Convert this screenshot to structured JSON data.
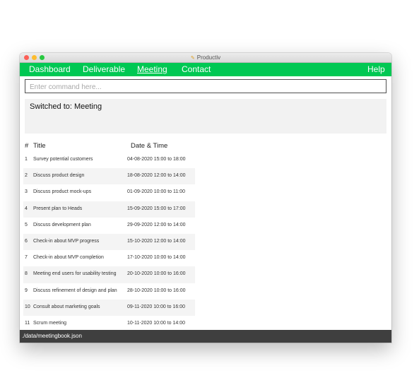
{
  "window": {
    "title": "Productiv",
    "icon": "app-icon"
  },
  "menu": {
    "items": [
      {
        "label": "Dashboard"
      },
      {
        "label": "Deliverable"
      },
      {
        "label": "Meeting",
        "active": true
      },
      {
        "label": "Contact"
      }
    ],
    "help_label": "Help"
  },
  "command": {
    "placeholder": "Enter command here...",
    "value": ""
  },
  "result": {
    "message": "Switched to: Meeting"
  },
  "table": {
    "headers": {
      "index": "#",
      "title": "Title",
      "datetime": "Date & Time"
    },
    "rows": [
      {
        "index": "1",
        "title": "Survey potential customers",
        "datetime": "04-08-2020 15:00 to 18:00"
      },
      {
        "index": "2",
        "title": "Discuss product design",
        "datetime": "18-08-2020 12:00 to 14:00"
      },
      {
        "index": "3",
        "title": "Discuss product mock-ups",
        "datetime": "01-09-2020 10:00 to 11:00"
      },
      {
        "index": "4",
        "title": "Present plan to Heads",
        "datetime": "15-09-2020 15:00 to 17:00"
      },
      {
        "index": "5",
        "title": "Discuss development plan",
        "datetime": "29-09-2020 12:00 to 14:00"
      },
      {
        "index": "6",
        "title": "Check-in about MVP progress",
        "datetime": "15-10-2020 12:00 to 14:00"
      },
      {
        "index": "7",
        "title": "Check-in about MVP completion",
        "datetime": "17-10-2020 10:00 to 14:00"
      },
      {
        "index": "8",
        "title": "Meeting end users for usability testing",
        "datetime": "20-10-2020 10:00 to 16:00"
      },
      {
        "index": "9",
        "title": "Discuss refinement of design and plan",
        "datetime": "28-10-2020 10:00 to 16:00"
      },
      {
        "index": "10",
        "title": "Consult about marketing goals",
        "datetime": "09-11-2020 10:00 to 16:00"
      },
      {
        "index": "11",
        "title": "Scrum meeting",
        "datetime": "10-11-2020 10:00 to 14:00"
      }
    ]
  },
  "status": {
    "path": "./data/meetingbook.json"
  },
  "colors": {
    "menubar": "#00c853",
    "statusbar": "#3f3f3f",
    "row_alt": "#f4f4f4"
  }
}
